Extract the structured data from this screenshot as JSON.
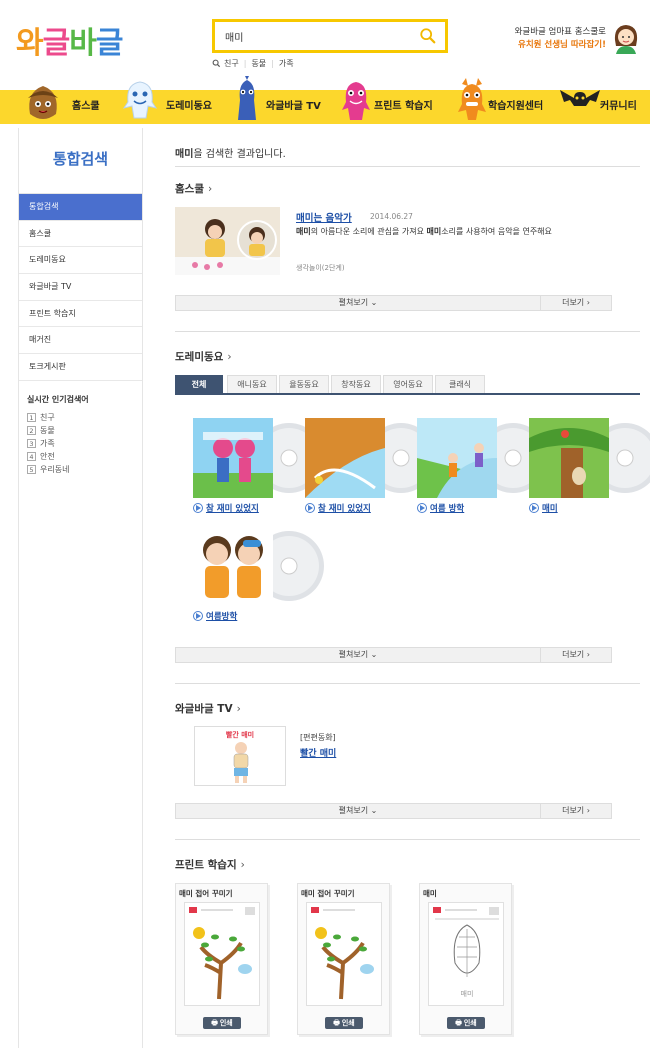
{
  "header": {
    "logo": "와글바글",
    "search": {
      "value": "매미",
      "placeholder": ""
    },
    "keywords": [
      "친구",
      "동물",
      "가족"
    ],
    "promo_line1": "와글바글 엄마표 홈스쿨로",
    "promo_line2": "유치원 선생님 따라잡기!"
  },
  "nav": {
    "items": [
      "홈스쿨",
      "도레미동요",
      "와글바글 TV",
      "프린트 학습지",
      "학습지원센터",
      "커뮤니티"
    ]
  },
  "sidebar": {
    "title": "통합검색",
    "items": [
      "통합검색",
      "홈스쿨",
      "도레미동요",
      "와글바글 TV",
      "프린트 학습지",
      "매거진",
      "토크게시판"
    ],
    "popular_title": "실시간 인기검색어",
    "popular": [
      {
        "rank": "1",
        "word": "친구"
      },
      {
        "rank": "2",
        "word": "동물"
      },
      {
        "rank": "3",
        "word": "가족"
      },
      {
        "rank": "4",
        "word": "안전"
      },
      {
        "rank": "5",
        "word": "우리동네"
      }
    ]
  },
  "main": {
    "result_keyword": "매미",
    "result_text": "을 검색한 결과입니다.",
    "expand_label": "펼쳐보기",
    "more_label": "더보기",
    "homeschool": {
      "heading": "홈스쿨",
      "title": "매미는 음악가",
      "date": "2014.06.27",
      "desc_pre": "의 아름다운 소리에 관심을 가져요 ",
      "desc_kw": "매미",
      "desc_post": "소리를 사용하여 음악을 연주해요",
      "category": "생각놀이(2단계)"
    },
    "songs": {
      "heading": "도레미동요",
      "tabs": [
        "전체",
        "애니동요",
        "율동동요",
        "창작동요",
        "영어동요",
        "클래식"
      ],
      "items": [
        "참 재미 있었지",
        "참 재미 있었지",
        "여름 방학",
        "매미",
        "여름방학"
      ]
    },
    "tv": {
      "heading": "와글바글 TV",
      "tag": "[편편동화]",
      "title": "빨간 매미",
      "thumb_text": "빨간 매미"
    },
    "print": {
      "heading": "프린트 학습지",
      "items": [
        "매미 접어 꾸미기",
        "매미 접어 꾸미기",
        "매미"
      ],
      "print_label": "인쇄",
      "sheet3_caption": "매미"
    }
  },
  "colors": {
    "accent": "#fcd72c",
    "sidebar_active": "#4a6fce",
    "link": "#1d4fa6",
    "tab_active": "#3e5371"
  }
}
